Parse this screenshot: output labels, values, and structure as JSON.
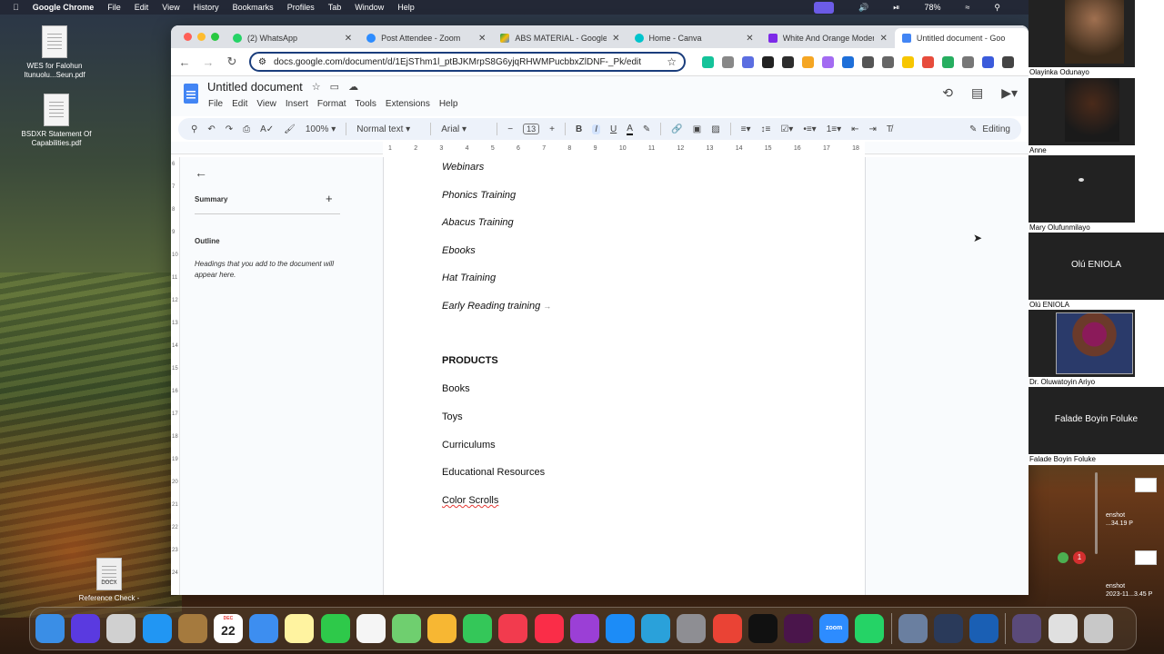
{
  "menubar": {
    "app_name": "Google Chrome",
    "items": [
      "File",
      "Edit",
      "View",
      "History",
      "Bookmarks",
      "Profiles",
      "Tab",
      "Window",
      "Help"
    ],
    "battery": "78%"
  },
  "desktop": {
    "icons": [
      {
        "label": "WES for Falohun Itunuolu...Seun.pdf"
      },
      {
        "label": "BSDXR Statement Of Capabilities.pdf"
      },
      {
        "label": "Reference Check -",
        "badge": "DOCX"
      }
    ],
    "screenshot_labels": [
      "enshot\n...34.19 P",
      "enshot\n2023-11...3.45 P"
    ]
  },
  "browser": {
    "tabs": [
      {
        "title": "(2) WhatsApp",
        "color": "#25d366"
      },
      {
        "title": "Post Attendee - Zoom",
        "color": "#2d8cff"
      },
      {
        "title": "ABS MATERIAL - Google Dr",
        "color": "#fbbc04"
      },
      {
        "title": "Home - Canva",
        "color": "#00c4cc"
      },
      {
        "title": "White And Orange Modern",
        "color": "#7d2ae8"
      },
      {
        "title": "Untitled document - Goo",
        "color": "#4285f4",
        "active": true
      }
    ],
    "url": "docs.google.com/document/d/1EjSThm1l_ptBJKMrpS8G6yjqRHWMPucbbxZlDNF-_Pk/edit",
    "extension_colors": [
      "#15c39a",
      "#888",
      "#5b6ee1",
      "#222",
      "#2d2d2d",
      "#f5a623",
      "#a36bf2",
      "#1e6fd9",
      "#555",
      "#666",
      "#f7c600",
      "#e74c3c",
      "#27ae60",
      "#777",
      "#3b5bdb",
      "#444"
    ]
  },
  "docs": {
    "title": "Untitled document",
    "menu": [
      "File",
      "Edit",
      "View",
      "Insert",
      "Format",
      "Tools",
      "Extensions",
      "Help"
    ],
    "toolbar": {
      "zoom": "100%",
      "style": "Normal text",
      "font": "Arial",
      "font_size": "13",
      "editing": "Editing"
    },
    "ruler_ticks": [
      "1",
      "2",
      "3",
      "4",
      "5",
      "6",
      "7",
      "8",
      "9",
      "10",
      "11",
      "12",
      "13",
      "14",
      "15",
      "16",
      "17",
      "18"
    ],
    "vruler_ticks": [
      "6",
      "7",
      "8",
      "9",
      "10",
      "11",
      "12",
      "13",
      "14",
      "15",
      "16",
      "17",
      "18",
      "19",
      "20",
      "21",
      "22",
      "23",
      "24"
    ],
    "outline": {
      "summary": "Summary",
      "outline_title": "Outline",
      "hint": "Headings that you add to the document will appear here."
    },
    "content": {
      "services": [
        "Webinars",
        "Phonics Training",
        "Abacus Training",
        "Ebooks",
        "Hat Training",
        "Early Reading training"
      ],
      "products_heading": "PRODUCTS",
      "products": [
        "Books",
        "Toys",
        "Curriculums",
        "Educational Resources",
        "Color Scrolls"
      ]
    }
  },
  "zoom": {
    "participants": [
      {
        "name": "Olayinka Odunayo",
        "video": true
      },
      {
        "name": "Anne",
        "video": true
      },
      {
        "name": "Mary Olufunmilayo",
        "video": true
      },
      {
        "name": "Olú ENIOLA",
        "display": "Olú ENIOLA",
        "video": false
      },
      {
        "name": "Dr. Oluwatoyin Ariyo",
        "video": true
      },
      {
        "name": "Falade Boyin Foluke",
        "display": "Falade Boyin Foluke",
        "video": false
      }
    ],
    "notification_count": "1"
  },
  "dock": {
    "calendar_month": "DEC",
    "calendar_day": "22",
    "apps": [
      {
        "name": "Finder",
        "color": "#3a8ee6"
      },
      {
        "name": "Siri",
        "color": "#5a3ae0"
      },
      {
        "name": "Launchpad",
        "color": "#d0d0d0"
      },
      {
        "name": "Safari",
        "color": "#2196f3"
      },
      {
        "name": "Brown App",
        "color": "#a57a3e"
      },
      {
        "name": "Calendar",
        "color": "#ffffff"
      },
      {
        "name": "Mail",
        "color": "#3d8ef0"
      },
      {
        "name": "Notes",
        "color": "#fff3a0"
      },
      {
        "name": "FaceTime",
        "color": "#2ec94a"
      },
      {
        "name": "Reminders",
        "color": "#f5f5f5"
      },
      {
        "name": "Maps",
        "color": "#6fcf6f"
      },
      {
        "name": "Photos",
        "color": "#f7b733"
      },
      {
        "name": "Messages",
        "color": "#34c759"
      },
      {
        "name": "News",
        "color": "#f23b4e"
      },
      {
        "name": "Music",
        "color": "#fa2d48"
      },
      {
        "name": "Podcasts",
        "color": "#9b3fd6"
      },
      {
        "name": "App Store",
        "color": "#1c8cf7"
      },
      {
        "name": "Telegram",
        "color": "#2aa1da"
      },
      {
        "name": "System Settings",
        "color": "#8e8e93"
      },
      {
        "name": "Chrome",
        "color": "#ea4335"
      },
      {
        "name": "Apple TV",
        "color": "#111111"
      },
      {
        "name": "Slack",
        "color": "#4a154b"
      },
      {
        "name": "Zoom",
        "color": "#2d8cff",
        "text": "zoom"
      },
      {
        "name": "WhatsApp",
        "color": "#25d366"
      }
    ],
    "recent": [
      {
        "name": "Screenshot Stack",
        "color": "#6a7fa0"
      },
      {
        "name": "QuickTime",
        "color": "#2a3a5a"
      },
      {
        "name": "Word",
        "color": "#1a5fb4"
      }
    ],
    "trailing": [
      {
        "name": "Downloads Stack",
        "color": "#5a4a7a"
      },
      {
        "name": "Documents Stack",
        "color": "#e0e0e0"
      },
      {
        "name": "Trash",
        "color": "#c8c8c8"
      }
    ]
  }
}
